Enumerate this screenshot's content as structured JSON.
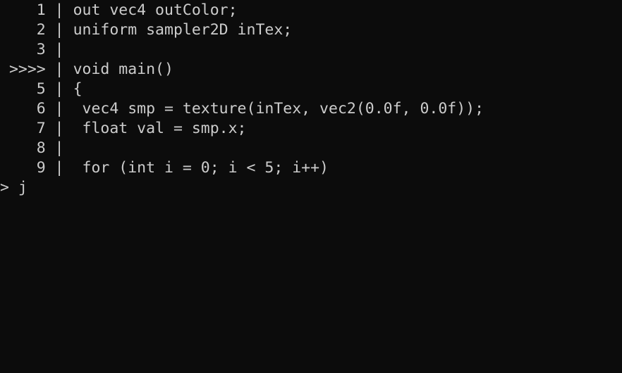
{
  "terminal": {
    "background": "#0c0c0c",
    "foreground": "#cccccc",
    "separator": " | ",
    "lines": [
      {
        "gutter": "1",
        "code": "out vec4 outColor;"
      },
      {
        "gutter": "2",
        "code": "uniform sampler2D inTex;"
      },
      {
        "gutter": "3",
        "code": ""
      },
      {
        "gutter": ">>>>",
        "code": "void main()"
      },
      {
        "gutter": "5",
        "code": "{"
      },
      {
        "gutter": "6",
        "code": " vec4 smp = texture(inTex, vec2(0.0f, 0.0f));"
      },
      {
        "gutter": "7",
        "code": " float val = smp.x;"
      },
      {
        "gutter": "8",
        "code": ""
      },
      {
        "gutter": "9",
        "code": " for (int i = 0; i < 5; i++)"
      }
    ],
    "prompt": {
      "marker": "> ",
      "input": "j"
    }
  }
}
